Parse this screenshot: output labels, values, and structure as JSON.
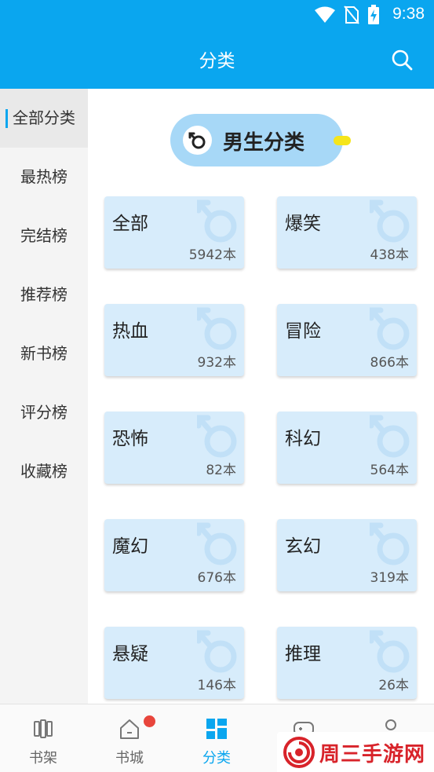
{
  "status_bar": {
    "time": "9:38"
  },
  "header": {
    "title": "分类"
  },
  "sidebar": {
    "items": [
      {
        "label": "全部分类",
        "active": true
      },
      {
        "label": "最热榜",
        "active": false
      },
      {
        "label": "完结榜",
        "active": false
      },
      {
        "label": "推荐榜",
        "active": false
      },
      {
        "label": "新书榜",
        "active": false
      },
      {
        "label": "评分榜",
        "active": false
      },
      {
        "label": "收藏榜",
        "active": false
      }
    ]
  },
  "gender_switch": {
    "label": "男生分类",
    "icon": "male-icon"
  },
  "categories": [
    {
      "name": "全部",
      "count": "5942本"
    },
    {
      "name": "爆笑",
      "count": "438本"
    },
    {
      "name": "热血",
      "count": "932本"
    },
    {
      "name": "冒险",
      "count": "866本"
    },
    {
      "name": "恐怖",
      "count": "82本"
    },
    {
      "name": "科幻",
      "count": "564本"
    },
    {
      "name": "魔幻",
      "count": "676本"
    },
    {
      "name": "玄幻",
      "count": "319本"
    },
    {
      "name": "悬疑",
      "count": "146本"
    },
    {
      "name": "推理",
      "count": "26本"
    }
  ],
  "bottom_nav": {
    "tabs": [
      {
        "label": "书架",
        "icon": "bookshelf-icon",
        "active": false
      },
      {
        "label": "书城",
        "icon": "home-icon",
        "active": false,
        "badge": true
      },
      {
        "label": "分类",
        "icon": "category-grid-icon",
        "active": true
      },
      {
        "label": "",
        "icon": "gamepad-icon",
        "active": false
      },
      {
        "label": "",
        "icon": "user-icon",
        "active": false
      }
    ]
  },
  "watermark": {
    "text": "周三手游网"
  },
  "colors": {
    "accent": "#0aa6ef",
    "card_bg": "#d7ecfb",
    "pill_bg": "#a7d8f7",
    "badge": "#e8453c"
  }
}
